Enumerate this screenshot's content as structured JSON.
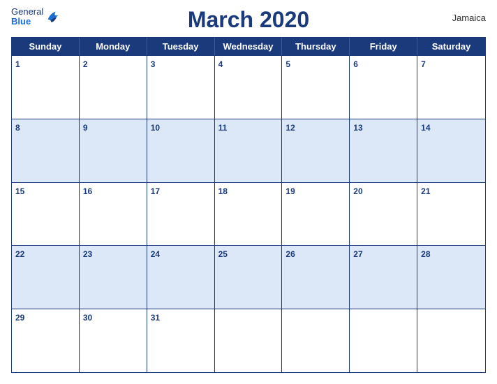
{
  "header": {
    "title": "March 2020",
    "region": "Jamaica",
    "logo_general": "General",
    "logo_blue": "Blue"
  },
  "days_of_week": [
    "Sunday",
    "Monday",
    "Tuesday",
    "Wednesday",
    "Thursday",
    "Friday",
    "Saturday"
  ],
  "weeks": [
    {
      "shaded": false,
      "days": [
        1,
        2,
        3,
        4,
        5,
        6,
        7
      ]
    },
    {
      "shaded": true,
      "days": [
        8,
        9,
        10,
        11,
        12,
        13,
        14
      ]
    },
    {
      "shaded": false,
      "days": [
        15,
        16,
        17,
        18,
        19,
        20,
        21
      ]
    },
    {
      "shaded": true,
      "days": [
        22,
        23,
        24,
        25,
        26,
        27,
        28
      ]
    },
    {
      "shaded": false,
      "days": [
        29,
        30,
        31,
        null,
        null,
        null,
        null
      ]
    }
  ]
}
